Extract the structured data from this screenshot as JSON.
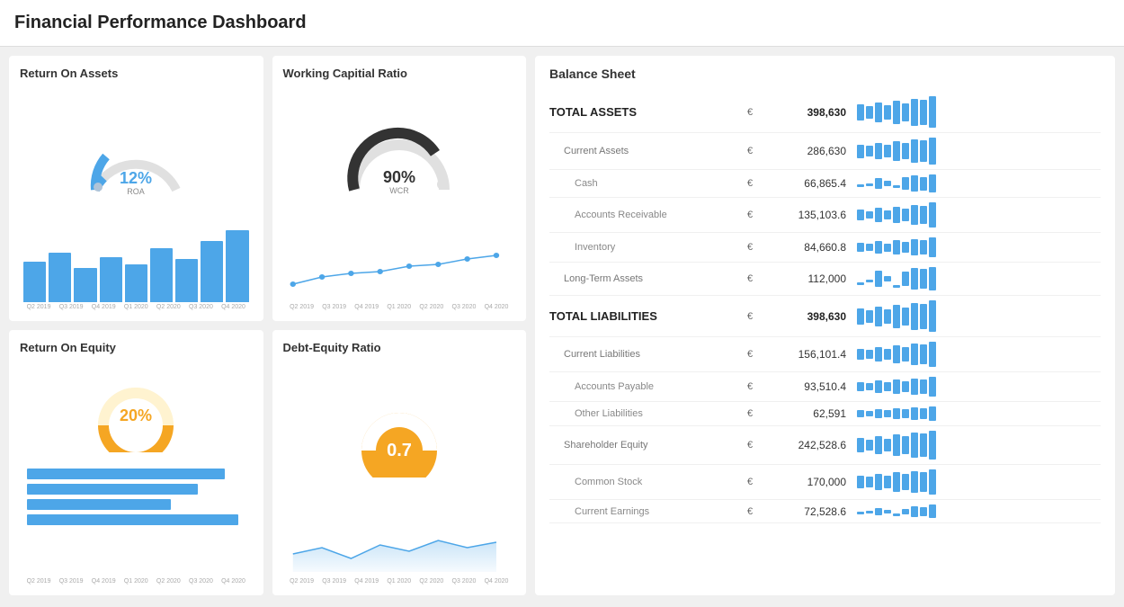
{
  "header": {
    "title": "Financial Performance Dashboard"
  },
  "panels": {
    "roa": {
      "title": "Return On Assets",
      "value": "12%",
      "sublabel": "ROA",
      "bars": [
        45,
        55,
        38,
        50,
        42,
        65,
        48,
        72,
        85
      ],
      "xLabels": [
        "Q2 2019",
        "Q3 2019",
        "Q4 2019",
        "Q1 2020",
        "Q2 2020",
        "Q3 2020",
        "Q4 2020"
      ]
    },
    "wcr": {
      "title": "Working Capitial Ratio",
      "value": "90%",
      "sublabel": "WCR"
    },
    "roe": {
      "title": "Return On Equity",
      "value": "20%",
      "hbars": [
        220,
        190,
        155,
        230
      ],
      "xLabels": [
        "Q2 2019",
        "Q3 2019",
        "Q4 2019",
        "Q1 2020",
        "Q2 2020",
        "Q3 2020",
        "Q4 2020"
      ]
    },
    "der": {
      "title": "Debt-Equity Ratio",
      "value": "0.7"
    }
  },
  "balanceSheet": {
    "title": "Balance Sheet",
    "rows": [
      {
        "label": "TOTAL ASSETS",
        "currency": "€",
        "value": "398,630",
        "bold": true,
        "indent": 0,
        "sparkHeights": [
          18,
          14,
          22,
          16,
          26,
          20,
          30,
          28,
          35
        ]
      },
      {
        "label": "Current Assets",
        "currency": "€",
        "value": "286,630",
        "bold": false,
        "indent": 1,
        "sparkHeights": [
          15,
          12,
          18,
          14,
          22,
          18,
          26,
          24,
          30
        ]
      },
      {
        "label": "Cash",
        "currency": "€",
        "value": "66,865.4",
        "bold": false,
        "indent": 2,
        "sparkHeights": [
          8,
          5,
          12,
          6,
          10,
          14,
          18,
          15,
          20
        ],
        "dashed": true
      },
      {
        "label": "Accounts Receivable",
        "currency": "€",
        "value": "135,103.6",
        "bold": false,
        "indent": 2,
        "sparkHeights": [
          12,
          8,
          16,
          10,
          18,
          14,
          22,
          20,
          28
        ]
      },
      {
        "label": "Inventory",
        "currency": "€",
        "value": "84,660.8",
        "bold": false,
        "indent": 2,
        "sparkHeights": [
          10,
          8,
          14,
          9,
          16,
          12,
          18,
          16,
          22
        ]
      },
      {
        "label": "Long-Term Assets",
        "currency": "€",
        "value": "112,000",
        "bold": false,
        "indent": 1,
        "sparkHeights": [
          14,
          8,
          18,
          6,
          20,
          16,
          24,
          22,
          26
        ],
        "dashed": true
      },
      {
        "label": "TOTAL LIABILITIES",
        "currency": "€",
        "value": "398,630",
        "bold": true,
        "indent": 0,
        "sparkHeights": [
          18,
          14,
          22,
          16,
          26,
          20,
          30,
          28,
          35
        ]
      },
      {
        "label": "Current Liabilities",
        "currency": "€",
        "value": "156,101.4",
        "bold": false,
        "indent": 1,
        "sparkHeights": [
          12,
          10,
          16,
          12,
          20,
          16,
          24,
          22,
          28
        ]
      },
      {
        "label": "Accounts Payable",
        "currency": "€",
        "value": "93,510.4",
        "bold": false,
        "indent": 2,
        "sparkHeights": [
          10,
          8,
          14,
          10,
          16,
          12,
          18,
          16,
          22
        ]
      },
      {
        "label": "Other Liabilities",
        "currency": "€",
        "value": "62,591",
        "bold": false,
        "indent": 2,
        "sparkHeights": [
          8,
          6,
          10,
          8,
          12,
          10,
          14,
          12,
          16
        ]
      },
      {
        "label": "Shareholder Equity",
        "currency": "€",
        "value": "242,528.6",
        "bold": false,
        "indent": 1,
        "sparkHeights": [
          16,
          12,
          20,
          14,
          24,
          20,
          28,
          26,
          32
        ]
      },
      {
        "label": "Common Stock",
        "currency": "€",
        "value": "170,000",
        "bold": false,
        "indent": 2,
        "sparkHeights": [
          14,
          12,
          18,
          14,
          22,
          18,
          24,
          22,
          28
        ]
      },
      {
        "label": "Current Earnings",
        "currency": "€",
        "value": "72,528.6",
        "bold": false,
        "indent": 2,
        "sparkHeights": [
          6,
          4,
          8,
          4,
          10,
          6,
          12,
          10,
          15
        ],
        "dashed": true
      }
    ]
  },
  "xLabels": [
    "Q2 2019",
    "Q3 2019",
    "Q4 2019",
    "Q1 2020",
    "Q2 2020",
    "Q3 2020",
    "Q4 2020"
  ]
}
